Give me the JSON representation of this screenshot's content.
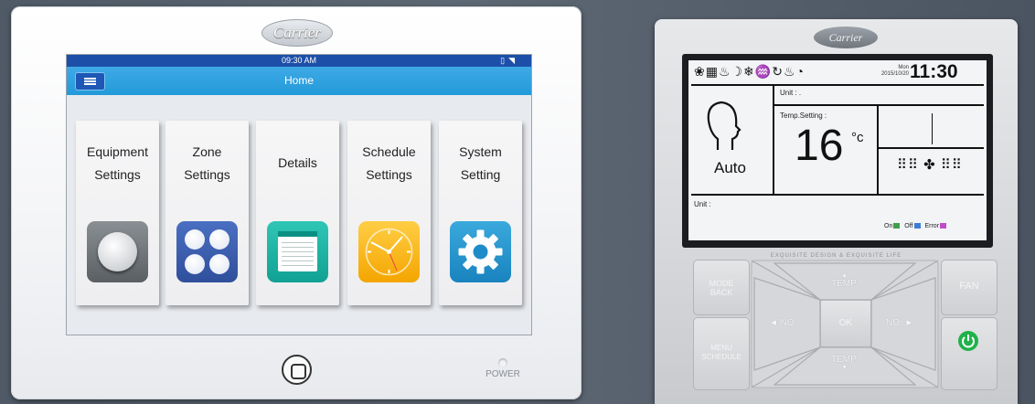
{
  "tablet": {
    "logo": "Carrier",
    "status_time": "09:30 AM",
    "header_title": "Home",
    "cards": [
      {
        "line1": "Equipment",
        "line2": "Settings"
      },
      {
        "line1": "Zone",
        "line2": "Settings"
      },
      {
        "line1": "Details",
        "line2": ""
      },
      {
        "line1": "Schedule",
        "line2": "Settings"
      },
      {
        "line1": "System",
        "line2": "Setting"
      }
    ],
    "power_label": "POWER"
  },
  "controller": {
    "logo": "Carrier",
    "lcd": {
      "date": "Mon\n2015/10/20",
      "time": "11:30",
      "unit_label_top": "Unit :  .",
      "temp_setting_label": "Temp.Setting :",
      "temperature": "16",
      "temp_unit": "°c",
      "mode": "Auto",
      "unit_label_bottom": "Unit :",
      "legend": {
        "on": "On",
        "off": "Off",
        "error": "Error"
      }
    },
    "tagline": "EXQUISITE DESIGN  &  EXQUISITE LIFE",
    "buttons": {
      "mode_back": "MODE\nBACK",
      "menu_schedule": "MENU\nSCHEDULE",
      "temp_up": "TEMP.",
      "temp_down": "TEMP.",
      "no_left": "◄ NO.",
      "no_right": "NO. ►",
      "ok": "OK",
      "fan": "FAN"
    },
    "colors": {
      "on": "#3ea04a",
      "off": "#3b7fd4",
      "error": "#c04cc9",
      "power": "#1fb24a"
    }
  }
}
